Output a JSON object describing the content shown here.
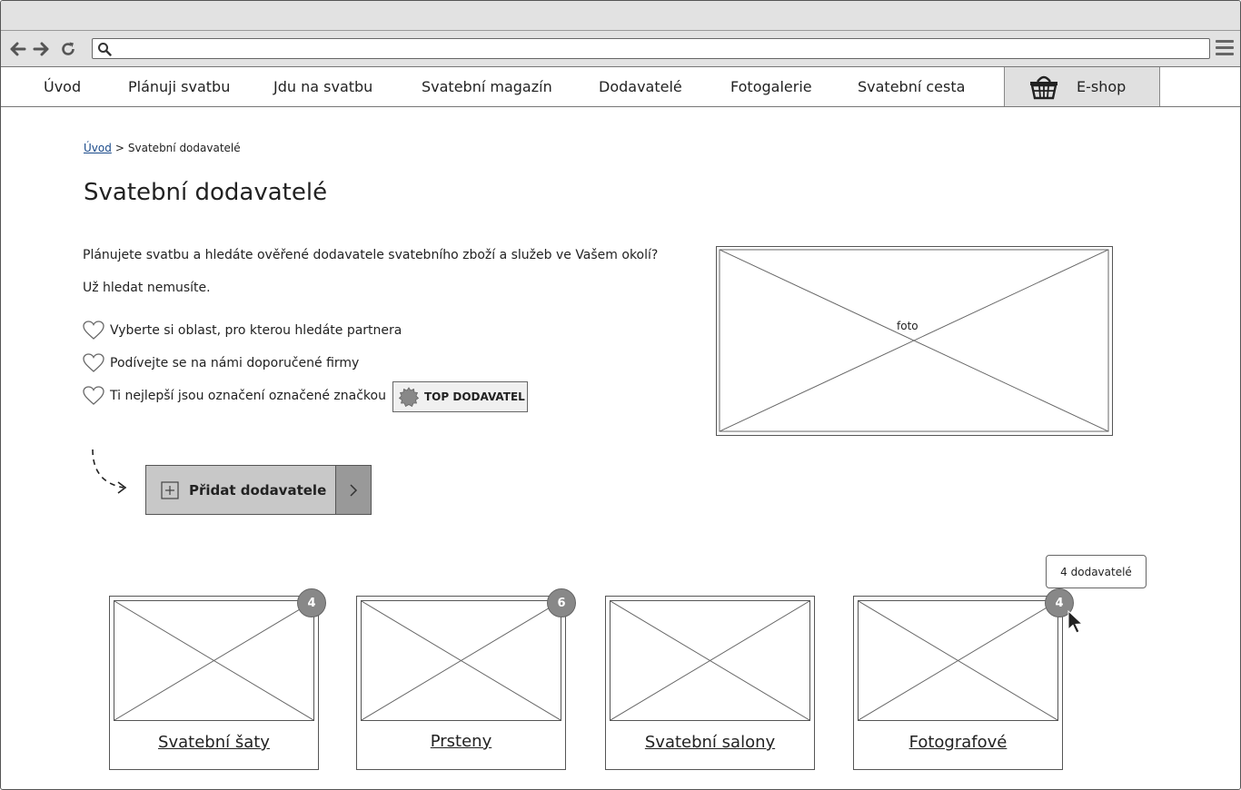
{
  "browser": {
    "url_value": "",
    "icons": [
      "back-arrow-icon",
      "forward-arrow-icon",
      "reload-icon",
      "search-icon",
      "hamburger-menu-icon"
    ]
  },
  "nav": {
    "items": [
      {
        "label": "Úvod"
      },
      {
        "label": "Plánuji svatbu"
      },
      {
        "label": "Jdu na svatbu"
      },
      {
        "label": "Svatební magazín"
      },
      {
        "label": "Dodavatelé"
      },
      {
        "label": "Fotogalerie"
      },
      {
        "label": "Svatební cesta"
      }
    ],
    "eshop_label": "E-shop",
    "eshop_icon": "basket-icon"
  },
  "breadcrumb": {
    "home": "Úvod",
    "separator": ">",
    "current": "Svatební dodavatelé"
  },
  "page": {
    "title": "Svatební dodavatelé",
    "intro_1": "Plánujete svatbu a hledáte ověřené dodavatele svatebního zboží a služeb ve Vašem okolí?",
    "intro_2": "Už hledat nemusíte.",
    "bullets": [
      "Vyberte si oblast, pro kterou hledáte partnera",
      "Podívejte se na námi doporučené firmy",
      "Ti nejlepší jsou označení označené značkou"
    ],
    "bullet_icon": "heart-icon",
    "top_badge": "TOP DODAVATEL",
    "photo_label": "foto",
    "add_button": "Přidat dodavatele"
  },
  "categories": [
    {
      "label": "Svatební šaty",
      "count": "4"
    },
    {
      "label": "Prsteny",
      "count": "6"
    },
    {
      "label": "Svatební salony",
      "count": ""
    },
    {
      "label": "Fotografové",
      "count": "4"
    }
  ],
  "tooltip": "4 dodavatelé",
  "colors": {
    "chrome": "#e2e2e2",
    "eshop_bg": "#e0e0e0",
    "add_button_bg": "#c8c8c8",
    "add_button_side": "#999999",
    "badge_bg": "#888888",
    "link": "#1a4a8a"
  }
}
